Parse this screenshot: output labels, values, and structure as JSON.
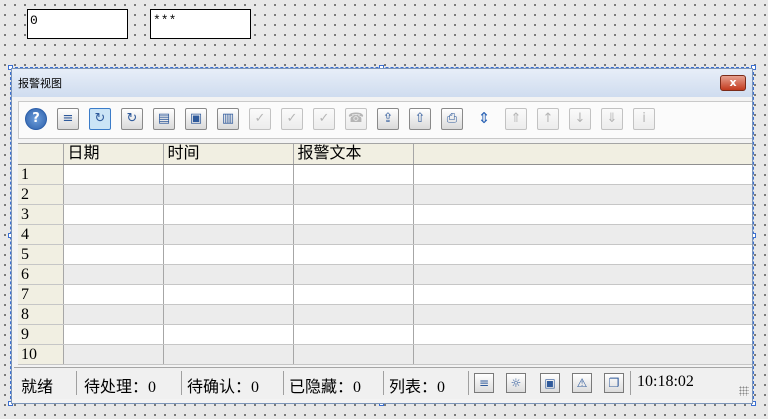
{
  "fields": {
    "field1_value": "0",
    "field2_value": "***"
  },
  "window": {
    "title": "报警视图",
    "close_label": "x"
  },
  "toolbar": {
    "buttons": [
      {
        "name": "help-icon",
        "glyph": "?",
        "state": "normal"
      },
      {
        "name": "message-list-icon",
        "glyph": "≡",
        "state": "normal"
      },
      {
        "name": "history-list-icon",
        "glyph": "↻",
        "state": "active"
      },
      {
        "name": "archive-list-icon",
        "glyph": "↻",
        "state": "normal"
      },
      {
        "name": "database-icon",
        "glyph": "▤",
        "state": "normal"
      },
      {
        "name": "lock-icon",
        "glyph": "▣",
        "state": "normal"
      },
      {
        "name": "statistics-icon",
        "glyph": "▥",
        "state": "normal"
      },
      {
        "name": "acknowledge-single-icon",
        "glyph": "✓",
        "state": "disabled"
      },
      {
        "name": "acknowledge-group-icon",
        "glyph": "✓",
        "state": "disabled"
      },
      {
        "name": "acknowledge-all-icon",
        "glyph": "✓",
        "state": "disabled"
      },
      {
        "name": "horn-icon",
        "glyph": "☎",
        "state": "disabled"
      },
      {
        "name": "loop-in-alarm-icon",
        "glyph": "⇪",
        "state": "normal"
      },
      {
        "name": "lock-export-icon",
        "glyph": "⇧",
        "state": "normal"
      },
      {
        "name": "print-icon",
        "glyph": "⎙",
        "state": "normal"
      },
      {
        "name": "sort-icon",
        "glyph": "⇕",
        "state": "plain"
      },
      {
        "name": "first-line-icon",
        "glyph": "⇑",
        "state": "disabled"
      },
      {
        "name": "previous-line-icon",
        "glyph": "↑",
        "state": "disabled"
      },
      {
        "name": "next-line-icon",
        "glyph": "↓",
        "state": "disabled"
      },
      {
        "name": "last-line-icon",
        "glyph": "⇓",
        "state": "disabled"
      },
      {
        "name": "info-text-icon",
        "glyph": "i",
        "state": "disabled"
      }
    ]
  },
  "table": {
    "columns": [
      "日期",
      "时间",
      "报警文本"
    ],
    "rows": [
      "1",
      "2",
      "3",
      "4",
      "5",
      "6",
      "7",
      "8",
      "9",
      "10"
    ]
  },
  "status": {
    "ready": "就绪",
    "pending": "待处理：0",
    "to_ack": "待确认：0",
    "hidden": "已隐藏：0",
    "list": "列表：0",
    "time": "10:18:02",
    "icons": [
      "list-view-icon",
      "lightbulb-icon",
      "lock-status-icon",
      "alarm-status-icon",
      "window-icon"
    ]
  }
}
